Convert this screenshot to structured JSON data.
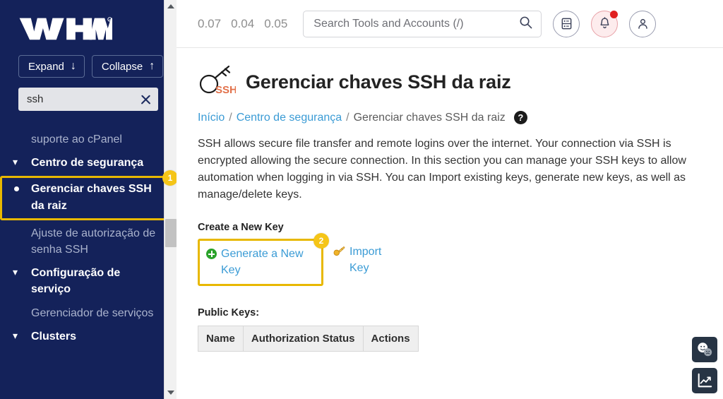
{
  "sidebar": {
    "logo_text": "WHM",
    "expand_button": "Expand",
    "collapse_button": "Collapse",
    "search_value": "ssh",
    "search_placeholder": "",
    "nav_items": [
      {
        "label": "suporte ao cPanel",
        "type": "plain",
        "active": false
      },
      {
        "label": "Centro de segurança",
        "type": "group",
        "active": false
      },
      {
        "label": "Gerenciar chaves SSH da raiz",
        "type": "child",
        "active": true,
        "badge": "1"
      },
      {
        "label": "Ajuste de autorização de senha SSH",
        "type": "plain",
        "active": false
      },
      {
        "label": "Configuração de serviço",
        "type": "group",
        "active": false
      },
      {
        "label": "Gerenciador de serviços",
        "type": "plain",
        "active": false
      },
      {
        "label": "Clusters",
        "type": "group",
        "active": false
      }
    ]
  },
  "topbar": {
    "load_averages": [
      "0.07",
      "0.04",
      "0.05"
    ],
    "search_placeholder": "Search Tools and Accounts (/)",
    "search_value": "",
    "icons": [
      {
        "name": "server-icon",
        "label": "Server"
      },
      {
        "name": "notifications-bell-icon",
        "label": "Notifications",
        "has_alert": true
      },
      {
        "name": "user-account-icon",
        "label": "Account"
      }
    ]
  },
  "page": {
    "icon_name": "ssh-key-icon",
    "icon_text": "SSH",
    "title": "Gerenciar chaves SSH da raiz",
    "breadcrumb": {
      "home": "Início",
      "section": "Centro de segurança",
      "current": "Gerenciar chaves SSH da raiz",
      "separator": "/",
      "help_glyph": "?"
    },
    "description": "SSH allows secure file transfer and remote logins over the internet. Your connection via SSH is encrypted allowing the secure connection. In this section you can manage your SSH keys to allow automation when logging in via SSH. You can Import existing keys, generate new keys, as well as manage/delete keys.",
    "create_section_label": "Create a New Key",
    "generate_key_label": "Generate a New Key",
    "generate_key_badge": "2",
    "import_key_label": "Import Key",
    "public_keys_label": "Public Keys:",
    "table": {
      "headers": [
        "Name",
        "Authorization Status",
        "Actions"
      ],
      "rows": []
    }
  },
  "widgets": [
    {
      "name": "feedback-faces-icon",
      "label": "Feedback"
    },
    {
      "name": "statistics-chart-icon",
      "label": "Statistics"
    }
  ],
  "colors": {
    "sidebar_bg": "#14225a",
    "highlight": "#e8b800",
    "badge": "#f5c518",
    "link": "#3a9bd5",
    "alert": "#e02020"
  }
}
